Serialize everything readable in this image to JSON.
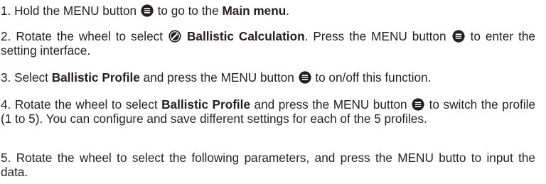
{
  "steps": [
    {
      "number": "1.",
      "text_a": "Hold the MENU button",
      "text_b": "to go to the",
      "bold_a": "Main menu",
      "text_c": "."
    },
    {
      "number": "2.",
      "text_a": "Rotate the wheel to select",
      "bold_a": "Ballistic Calculation",
      "text_b": ". Press the MENU button",
      "text_c": "to enter the setting interface."
    },
    {
      "number": "3.",
      "text_a": "Select",
      "bold_a": "Ballistic Profile",
      "text_b": "and press the MENU button",
      "text_c": "to on/off this function."
    },
    {
      "number": "4.",
      "text_a": "Rotate the wheel to select",
      "bold_a": "Ballistic Profile",
      "text_b": "and press the MENU button",
      "text_c": "to switch the profile (1 to 5). You can configure and save different settings for each of the 5 profiles."
    },
    {
      "number": "5.",
      "text_a": "Rotate the wheel to select the following parameters, and press the MENU butto to input the data."
    }
  ],
  "icons": {
    "menu": "menu-button-icon",
    "ballistic": "ballistic-calculation-icon"
  }
}
